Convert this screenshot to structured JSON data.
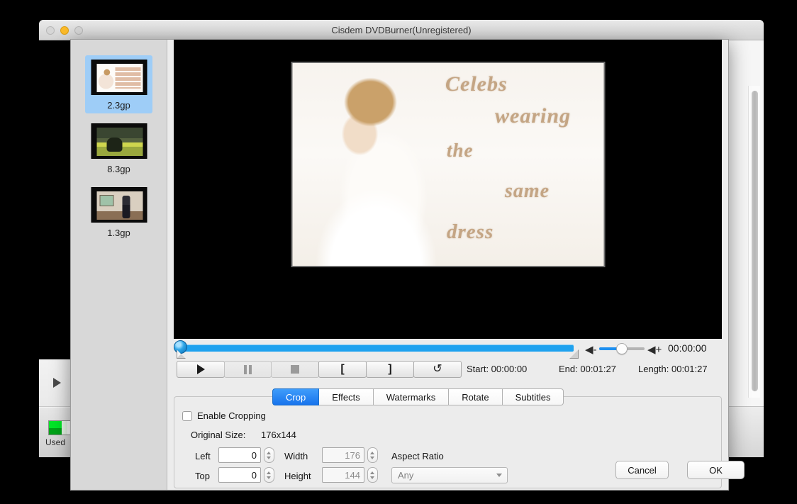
{
  "background_window": {
    "title": "Cisdem DVDBurner(Unregistered)",
    "traffic_lights": [
      "close",
      "minimize",
      "zoom"
    ],
    "disc_usage_label": "Used"
  },
  "dialog": {
    "thumbnails": [
      {
        "label": "2.3gp",
        "selected": true
      },
      {
        "label": "8.3gp",
        "selected": false
      },
      {
        "label": "1.3gp",
        "selected": false
      }
    ],
    "preview": {
      "caption_lines": [
        "Celebs",
        "wearing",
        "the",
        "same",
        "dress"
      ]
    },
    "transport": {
      "play": "play-icon",
      "pause": "pause-icon",
      "stop": "stop-icon",
      "mark_in": "[",
      "mark_out": "]",
      "reset": "↺",
      "volume_minus": "◀-",
      "volume_plus": "◀+",
      "current_time": "00:00:00",
      "start_label": "Start: 00:00:00",
      "end_label": "End: 00:01:27",
      "length_label": "Length: 00:01:27"
    },
    "tabs": [
      {
        "label": "Crop",
        "active": true
      },
      {
        "label": "Effects",
        "active": false
      },
      {
        "label": "Watermarks",
        "active": false
      },
      {
        "label": "Rotate",
        "active": false
      },
      {
        "label": "Subtitles",
        "active": false
      }
    ],
    "crop": {
      "enable_label": "Enable Cropping",
      "enabled": false,
      "original_size_label": "Original Size:",
      "original_size_value": "176x144",
      "left_label": "Left",
      "left_value": "0",
      "top_label": "Top",
      "top_value": "0",
      "width_label": "Width",
      "width_value": "176",
      "height_label": "Height",
      "height_value": "144",
      "aspect_ratio_label": "Aspect Ratio",
      "aspect_ratio_value": "Any"
    },
    "footer": {
      "cancel_label": "Cancel",
      "ok_label": "OK"
    }
  },
  "colors": {
    "accent_blue": "#1773ec",
    "seek_blue": "#1fa2ef",
    "selection_blue": "#9ecdf7"
  }
}
